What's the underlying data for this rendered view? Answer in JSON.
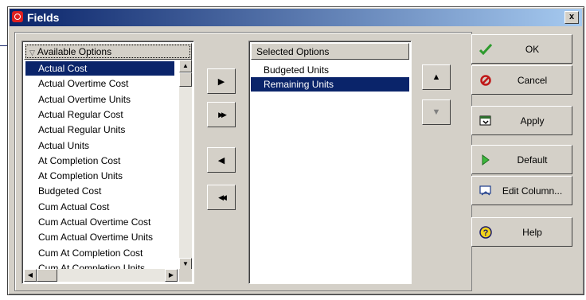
{
  "window": {
    "title": "Fields",
    "close_label": "x"
  },
  "available": {
    "header": "Available Options",
    "items": [
      "Actual Cost",
      "Actual Overtime Cost",
      "Actual Overtime Units",
      "Actual Regular Cost",
      "Actual Regular Units",
      "Actual Units",
      "At Completion Cost",
      "At Completion Units",
      "Budgeted Cost",
      "Cum Actual Cost",
      "Cum Actual Overtime Cost",
      "Cum Actual Overtime Units",
      "Cum At Completion Cost",
      "Cum At Completion Units"
    ],
    "selected_item": "Actual Cost"
  },
  "selected_options": {
    "header": "Selected Options",
    "items": [
      "Budgeted Units",
      "Remaining Units"
    ],
    "selected_item": "Remaining Units"
  },
  "move_buttons": {
    "add": "▶",
    "add_all": "▶▶",
    "remove": "◀",
    "remove_all": "◀◀"
  },
  "order_buttons": {
    "up": "▲",
    "down": "▼"
  },
  "buttons": {
    "ok": "OK",
    "cancel": "Cancel",
    "apply": "Apply",
    "default": "Default",
    "edit_column": "Edit Column...",
    "help": "Help"
  },
  "icons": {
    "ok": "checkmark-icon",
    "cancel": "no-entry-icon",
    "apply": "apply-icon",
    "default": "play-triangle-icon",
    "edit_column": "edit-column-icon",
    "help": "help-question-icon"
  },
  "colors": {
    "title_bar": "#0a246a",
    "selection": "#0a246a",
    "dialog_bg": "#d4d0c8",
    "ok_green": "#2e9b2e",
    "cancel_red": "#c01818",
    "help_yellow": "#f2d21b"
  }
}
